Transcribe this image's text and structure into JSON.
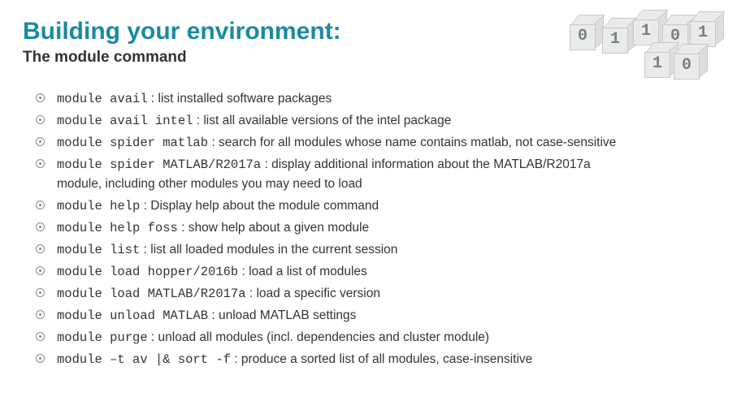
{
  "title": "Building your environment:",
  "subtitle": "The module command",
  "items": [
    {
      "cmd": "module avail",
      "desc": " : list installed software packages"
    },
    {
      "cmd": "module avail intel",
      "desc": " : list all available versions of the intel package"
    },
    {
      "cmd": "module spider matlab",
      "desc": " : search for all modules whose name contains matlab, not case-sensitive"
    },
    {
      "cmd": "module spider MATLAB/R2017a",
      "desc": " : display additional information about the MATLAB/R2017a",
      "cont": "module, including other modules you may need to load"
    },
    {
      "cmd": "module help",
      "desc": " : Display help about the module command"
    },
    {
      "cmd": "module help foss",
      "desc": " : show help about a given module"
    },
    {
      "cmd": "module list",
      "desc": " : list all loaded modules in the current session"
    },
    {
      "cmd": "module load hopper/2016b",
      "desc": " : load a list of modules"
    },
    {
      "cmd": "module load MATLAB/R2017a",
      "desc": " : load a specific version"
    },
    {
      "cmd": "module unload MATLAB",
      "desc": " : unload MATLAB settings"
    },
    {
      "cmd": "module purge",
      "desc": " : unload all modules (incl. dependencies and cluster module)"
    },
    {
      "cmd": "module –t av |& sort -f",
      "desc": " : produce a sorted list of all modules, case-insensitive"
    }
  ],
  "decoration": {
    "cubes": [
      "0",
      "1",
      "1",
      "0",
      "1",
      "1",
      "0"
    ]
  }
}
